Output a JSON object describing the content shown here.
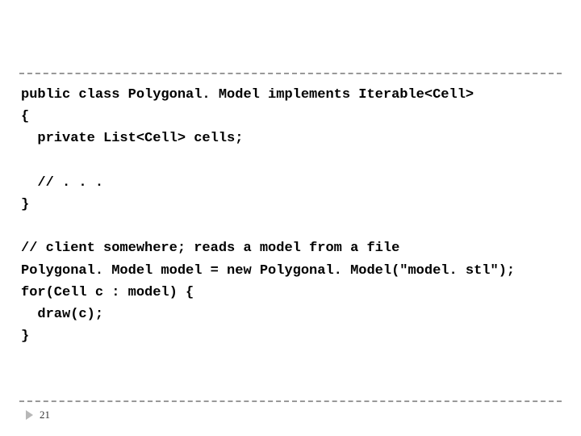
{
  "code": {
    "line1": "public class Polygonal. Model implements Iterable<Cell>",
    "line2": "{",
    "line3": "  private List<Cell> cells;",
    "line4": "",
    "line5": "  // . . .",
    "line6": "}",
    "line7": "",
    "line8": "// client somewhere; reads a model from a file",
    "line9": "Polygonal. Model model = new Polygonal. Model(\"model. stl\");",
    "line10": "for(Cell c : model) {",
    "line11": "  draw(c);",
    "line12": "}"
  },
  "footer": {
    "page_number": "21"
  }
}
